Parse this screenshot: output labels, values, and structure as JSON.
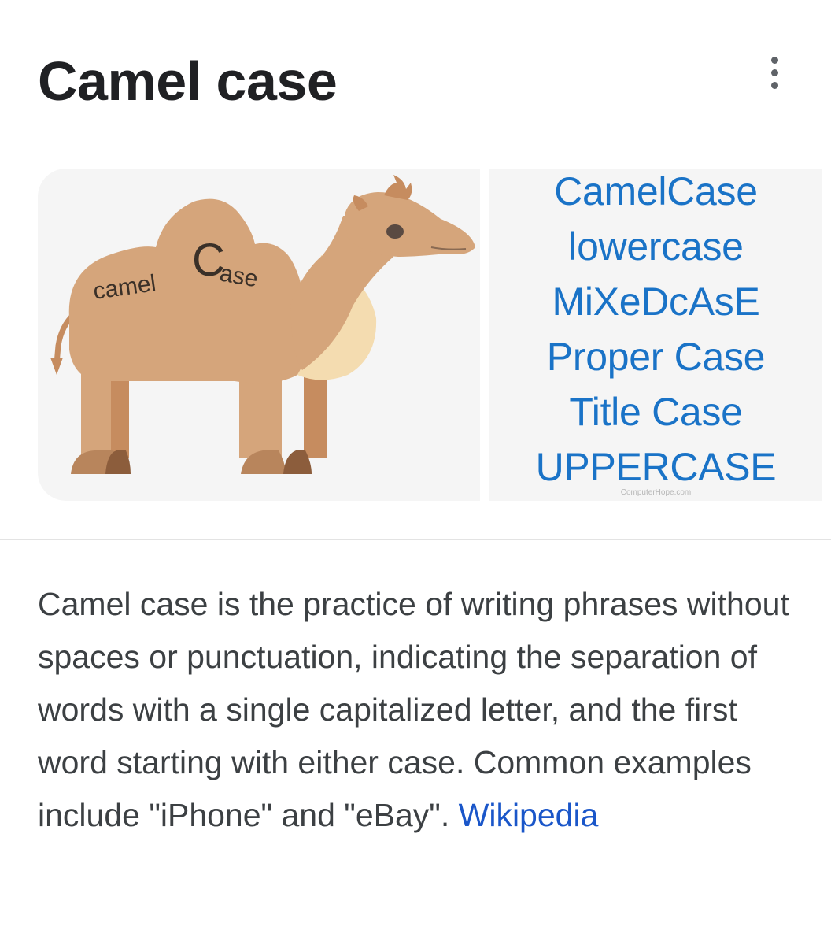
{
  "header": {
    "title": "Camel case",
    "more_icon": "more-vert-icon"
  },
  "images": {
    "left": {
      "label_part1": "camel",
      "label_part2": "C",
      "label_part3": "ase"
    },
    "right": {
      "examples": [
        "CamelCase",
        "lowercase",
        "MiXeDcAsE",
        "Proper Case",
        "Title Case",
        "UPPERCASE"
      ],
      "watermark": "ComputerHope.com"
    }
  },
  "description": {
    "text": "Camel case is the practice of writing phrases without spaces or punctuation, indicating the separation of words with a single capitalized letter, and the first word starting with either case. Common examples include \"iPhone\" and \"eBay\".",
    "source_label": "Wikipedia"
  },
  "colors": {
    "title": "#202124",
    "body_text": "#3c4043",
    "link": "#1a56c9",
    "case_text": "#1a73c7",
    "camel_body": "#d5a57b",
    "camel_dark": "#c68c5f",
    "camel_chest": "#f4dcb0",
    "hoof": "#8c5d3c"
  }
}
